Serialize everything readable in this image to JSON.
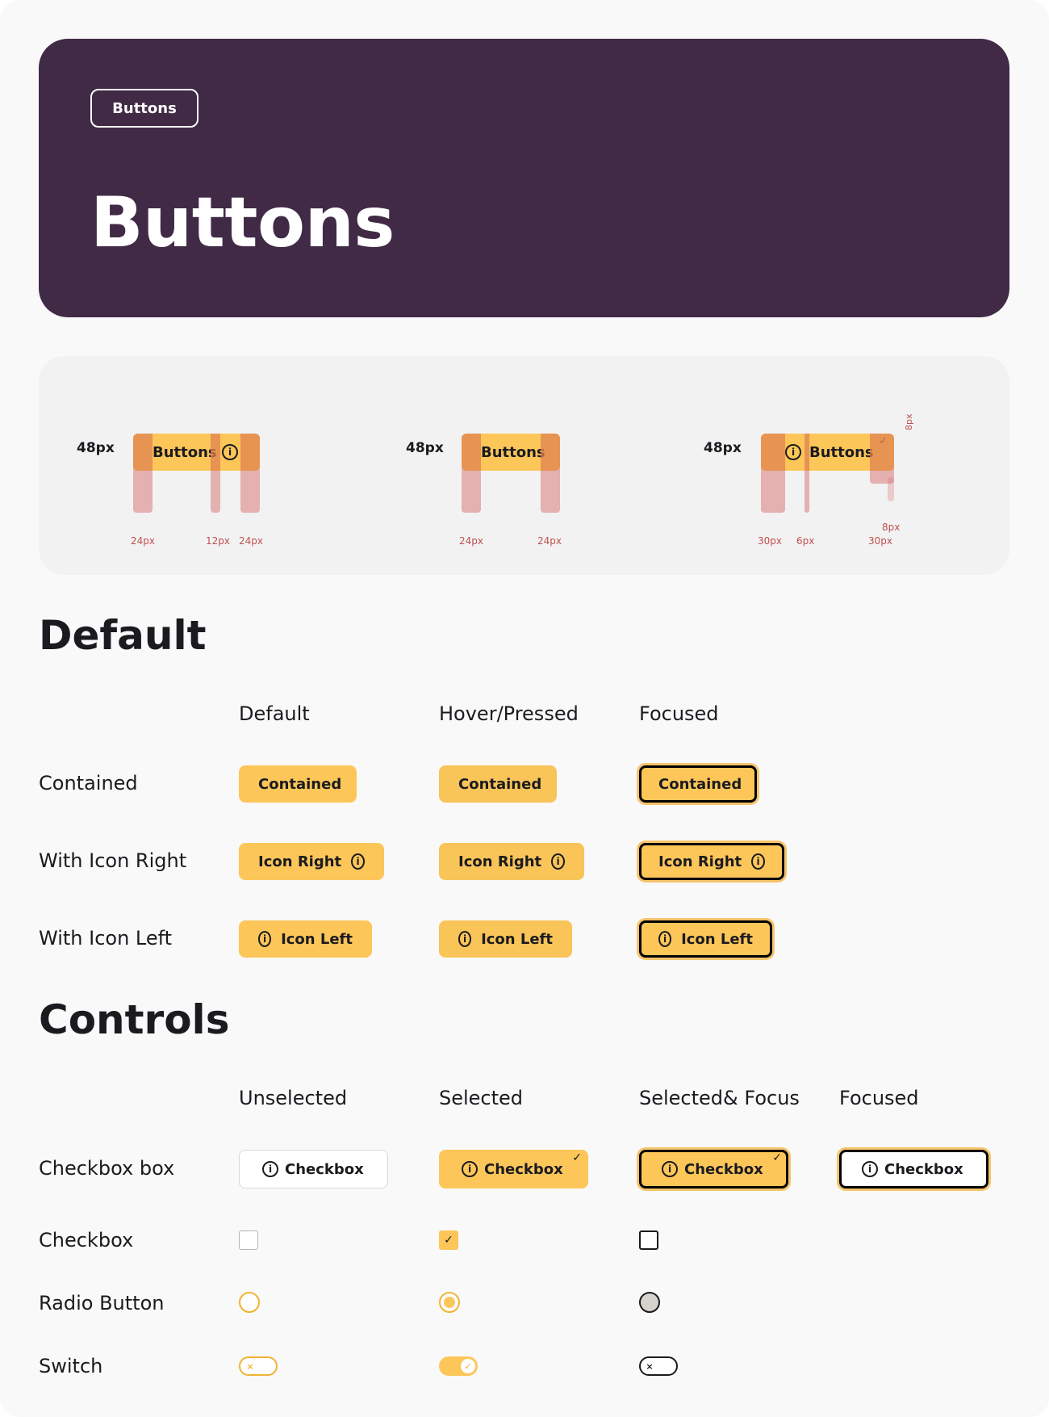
{
  "hero": {
    "badge": "Buttons",
    "title": "Buttons"
  },
  "anatomy": {
    "groups": [
      {
        "size": "48px",
        "label": "Buttons",
        "icon": "info-icon",
        "margins": [
          "24px",
          "12px",
          "24px"
        ]
      },
      {
        "size": "48px",
        "label": "Buttons",
        "margins": [
          "24px",
          "24px"
        ]
      },
      {
        "size": "48px",
        "label": "Buttons",
        "icon": "info-icon",
        "check": "✓",
        "margins": [
          "30px",
          "6px",
          "30px"
        ],
        "side": "8px",
        "corner": "8px"
      }
    ]
  },
  "default_section": {
    "title": "Default",
    "columns": [
      "Default",
      "Hover/Pressed",
      "Focused"
    ],
    "rows": [
      {
        "label": "Contained",
        "button": "Contained"
      },
      {
        "label": "With Icon Right",
        "button": "Icon Right"
      },
      {
        "label": "With Icon Left",
        "button": "Icon Left"
      }
    ]
  },
  "controls_section": {
    "title": "Controls",
    "columns": [
      "Unselected",
      "Selected",
      "Selected& Focus",
      "Focused"
    ],
    "rows": [
      "Checkbox box",
      "Checkbox",
      "Radio Button",
      "Switch"
    ],
    "checkbox_box_label": "Checkbox"
  },
  "colors": {
    "hero_bg": "#402a46",
    "accent": "#fcc659",
    "page_bg": "#f9f9fa"
  }
}
